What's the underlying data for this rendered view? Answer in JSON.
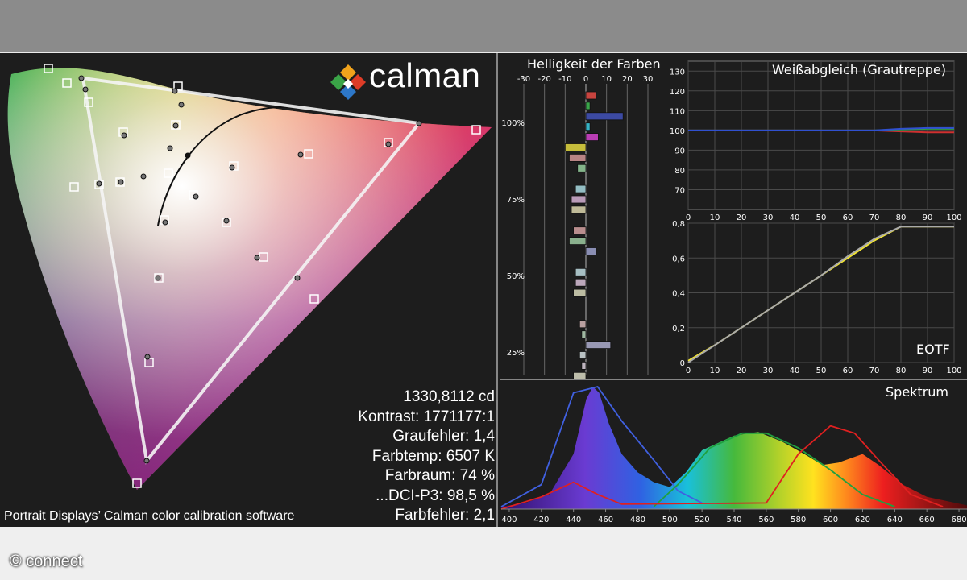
{
  "brand": {
    "logo_text": "calman",
    "caption": "Portrait Displays’ Calman color calibration software",
    "credit": "© connect"
  },
  "stats": [
    "1330,8112 cd",
    "Kontrast: 1771177:1",
    "Graufehler: 1,4",
    "Farbtemp: 6507 K",
    "Farbraum: 74 %",
    "...DCI-P3: 98,5 %",
    "Farbfehler: 2,1"
  ],
  "colors": {
    "panel": "#1d1d1d",
    "grid": "#555555",
    "yellow": "#f2e431",
    "white": "#ffffff"
  },
  "chart_data": [
    {
      "type": "scatter",
      "name_hint": "CIE gamut",
      "gamut_triangle": [
        [
          0.64,
          0.33
        ],
        [
          0.3,
          0.6
        ],
        [
          0.15,
          0.06
        ]
      ],
      "white_point": [
        0.3127,
        0.329
      ]
    },
    {
      "type": "bar",
      "title": "Helligkeit der Farben",
      "xlim": [
        -30,
        30
      ],
      "x_ticks": [
        "-30",
        "-20",
        "-10",
        "0",
        "10",
        "20",
        "30"
      ],
      "y_labels": [
        "100%",
        "75%",
        "50%",
        "25%"
      ],
      "bars": [
        {
          "value": 5,
          "color": "#c8443f"
        },
        {
          "value": 2,
          "color": "#3aa64a"
        },
        {
          "value": 18,
          "color": "#3c4aa3"
        },
        {
          "value": 2,
          "color": "#35b4c6"
        },
        {
          "value": 6,
          "color": "#b93db3"
        },
        {
          "value": -10,
          "color": "#c6bd3b"
        },
        {
          "value": -8,
          "color": "#b98484"
        },
        {
          "value": -4,
          "color": "#84b48a"
        },
        {
          "value": 0,
          "color": "#888888"
        },
        {
          "value": -5,
          "color": "#94bec4"
        },
        {
          "value": -7,
          "color": "#b99bb8"
        },
        {
          "value": -7,
          "color": "#bfba98"
        },
        {
          "value": 0,
          "color": "#888888"
        },
        {
          "value": -6,
          "color": "#b98e8e"
        },
        {
          "value": -8,
          "color": "#8ab08d"
        },
        {
          "value": 5,
          "color": "#8a8eb3"
        },
        {
          "value": 0,
          "color": "#888888"
        },
        {
          "value": -5,
          "color": "#a7bfc3"
        },
        {
          "value": -5,
          "color": "#bca8bb"
        },
        {
          "value": -6,
          "color": "#bcbca2"
        },
        {
          "value": 0,
          "color": "#888888"
        },
        {
          "value": 0,
          "color": "#888888"
        },
        {
          "value": -3,
          "color": "#b9a0a0"
        },
        {
          "value": -2,
          "color": "#a0b8a2"
        },
        {
          "value": 12,
          "color": "#9898b4"
        },
        {
          "value": -3,
          "color": "#b9c1c3"
        },
        {
          "value": -2,
          "color": "#bfb5bf"
        },
        {
          "value": -6,
          "color": "#bdbdaa"
        }
      ]
    },
    {
      "type": "line",
      "title": "Weißabgleich (Grautreppe)",
      "x": [
        0,
        10,
        20,
        30,
        40,
        50,
        60,
        70,
        80,
        90,
        100
      ],
      "xlim": [
        0,
        100
      ],
      "ylim": [
        60,
        135
      ],
      "y_ticks": [
        "70",
        "80",
        "90",
        "100",
        "110",
        "120",
        "130"
      ],
      "series": [
        {
          "color": "#d03030",
          "values": [
            100,
            100,
            100,
            100,
            100,
            100,
            100,
            100,
            99.5,
            99,
            99
          ]
        },
        {
          "color": "#30a040",
          "values": [
            100,
            100,
            100,
            100,
            100,
            100,
            100,
            100,
            100.5,
            100.8,
            100.8
          ]
        },
        {
          "color": "#3050d0",
          "values": [
            100,
            100,
            100,
            100,
            100,
            100,
            100,
            100,
            100.8,
            101.2,
            101.2
          ]
        }
      ]
    },
    {
      "type": "line",
      "title": "EOTF",
      "x": [
        0,
        10,
        20,
        30,
        40,
        50,
        60,
        70,
        80,
        90,
        100
      ],
      "xlim": [
        0,
        100
      ],
      "ylim": [
        0,
        0.8
      ],
      "y_ticks": [
        "0",
        "0,2",
        "0,4",
        "0,6",
        "0,8"
      ],
      "series": [
        {
          "color": "#f2e431",
          "values": [
            0.01,
            0.1,
            0.2,
            0.3,
            0.4,
            0.5,
            0.6,
            0.7,
            0.78,
            0.78,
            0.78
          ]
        },
        {
          "color": "#aaaaaa",
          "values": [
            0.0,
            0.1,
            0.2,
            0.3,
            0.4,
            0.5,
            0.61,
            0.71,
            0.78,
            0.78,
            0.78
          ]
        }
      ]
    },
    {
      "type": "area",
      "title": "Spektrum",
      "x_ticks": [
        "400",
        "420",
        "440",
        "460",
        "480",
        "500",
        "520",
        "540",
        "560",
        "580",
        "600",
        "620",
        "640",
        "660",
        "680"
      ],
      "xlim": [
        395,
        685
      ],
      "spectrum": [
        [
          395,
          0.02
        ],
        [
          410,
          0.05
        ],
        [
          425,
          0.12
        ],
        [
          440,
          0.45
        ],
        [
          448,
          0.9
        ],
        [
          452,
          1.0
        ],
        [
          456,
          0.95
        ],
        [
          462,
          0.7
        ],
        [
          470,
          0.45
        ],
        [
          480,
          0.3
        ],
        [
          490,
          0.22
        ],
        [
          500,
          0.18
        ],
        [
          510,
          0.3
        ],
        [
          520,
          0.48
        ],
        [
          540,
          0.6
        ],
        [
          555,
          0.63
        ],
        [
          570,
          0.55
        ],
        [
          585,
          0.44
        ],
        [
          595,
          0.36
        ],
        [
          605,
          0.38
        ],
        [
          620,
          0.45
        ],
        [
          630,
          0.36
        ],
        [
          645,
          0.2
        ],
        [
          660,
          0.1
        ],
        [
          685,
          0.03
        ]
      ],
      "reference_curves": [
        {
          "color": "#4060e0",
          "points": [
            [
              395,
              0.02
            ],
            [
              420,
              0.2
            ],
            [
              440,
              0.95
            ],
            [
              455,
              1.0
            ],
            [
              470,
              0.72
            ],
            [
              490,
              0.4
            ],
            [
              505,
              0.15
            ],
            [
              520,
              0.05
            ]
          ]
        },
        {
          "color": "#20a040",
          "points": [
            [
              490,
              0.02
            ],
            [
              505,
              0.2
            ],
            [
              525,
              0.5
            ],
            [
              545,
              0.62
            ],
            [
              560,
              0.62
            ],
            [
              580,
              0.5
            ],
            [
              600,
              0.32
            ],
            [
              620,
              0.12
            ],
            [
              640,
              0.02
            ]
          ]
        },
        {
          "color": "#e02020",
          "points": [
            [
              395,
              0.0
            ],
            [
              420,
              0.1
            ],
            [
              440,
              0.22
            ],
            [
              455,
              0.12
            ],
            [
              470,
              0.04
            ],
            [
              560,
              0.05
            ],
            [
              580,
              0.45
            ],
            [
              600,
              0.68
            ],
            [
              615,
              0.62
            ],
            [
              630,
              0.4
            ],
            [
              650,
              0.12
            ],
            [
              670,
              0.02
            ]
          ]
        }
      ]
    }
  ]
}
